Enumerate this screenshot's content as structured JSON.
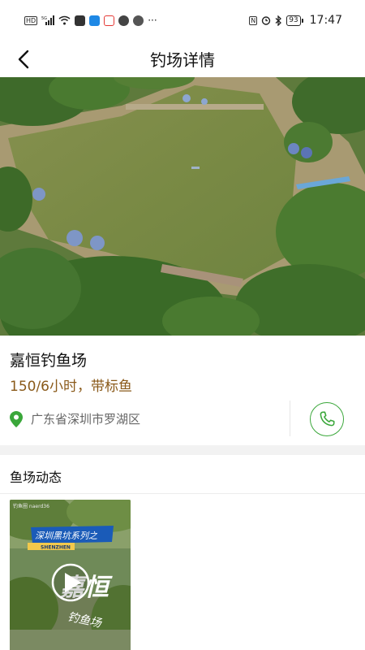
{
  "status_bar": {
    "network_badge": "HD",
    "signal_label": "5G",
    "more": "···",
    "nfc": "N",
    "battery": "93",
    "time": "17:47"
  },
  "nav": {
    "title": "钓场详情"
  },
  "venue": {
    "name": "嘉恒钓鱼场",
    "price": "150/6小时，带标鱼",
    "address": "广东省深圳市罗湖区"
  },
  "section": {
    "title": "鱼场动态"
  },
  "video": {
    "header_text": "深圳黑坑系列之",
    "tag_text": "SHENZHEN",
    "watermark": "钓鱼圈 naerd36",
    "logo_big": "嘉恒",
    "logo_small": "钓鱼场"
  },
  "colors": {
    "accent_green": "#3aa73a",
    "price_brown": "#8a5a1a",
    "banner_blue": "#1a5bb8",
    "tag_yellow": "#f2c94c"
  }
}
